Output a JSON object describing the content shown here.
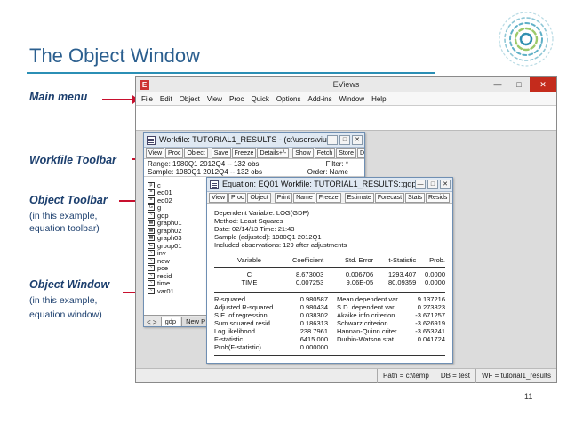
{
  "slide": {
    "title": "The Object Window",
    "page_number": "11"
  },
  "labels": {
    "main_menu": "Main menu",
    "workfile_toolbar": "Workfile Toolbar",
    "object_toolbar": "Object Toolbar",
    "object_toolbar_sub1": "(in this example,",
    "object_toolbar_sub2": "equation toolbar)",
    "object_window": "Object Window",
    "object_window_sub1": "(in this example,",
    "object_window_sub2": "equation window)"
  },
  "colors": {
    "title": "#2b5f8f",
    "label": "#1c3f6e",
    "arrow": "#c8102e",
    "close_button": "#c42b1c"
  },
  "eviews": {
    "app_title": "EViews",
    "menu": [
      "File",
      "Edit",
      "Object",
      "View",
      "Proc",
      "Quick",
      "Options",
      "Add-ins",
      "Window",
      "Help"
    ],
    "status": {
      "path": "Path = c:\\temp",
      "db": "DB = test",
      "wf": "WF = tutorial1_results"
    }
  },
  "workfile": {
    "title": "Workfile: TUTORIAL1_RESULTS - (c:\\users\\viu3...",
    "toolbar": [
      "View",
      "Proc",
      "Object",
      "Save",
      "Freeze",
      "Details+/-",
      "Show",
      "Fetch",
      "Store",
      "Delete",
      "Ge"
    ],
    "range_label": "Range:  1980Q1 2012Q4  --  132 obs",
    "sample_label": "Sample: 1980Q1 2012Q4  --  132 obs",
    "filter": "Filter: *",
    "order": "Order: Name",
    "objects": [
      {
        "glyph": "β",
        "name": "c"
      },
      {
        "glyph": "=",
        "name": "eq01"
      },
      {
        "glyph": "=",
        "name": "eq02"
      },
      {
        "glyph": "G",
        "name": "g"
      },
      {
        "glyph": "~",
        "name": "gdp"
      },
      {
        "glyph": "▦",
        "name": "graph01"
      },
      {
        "glyph": "▦",
        "name": "graph02"
      },
      {
        "glyph": "▦",
        "name": "graph03"
      },
      {
        "glyph": "G",
        "name": "group01"
      },
      {
        "glyph": "~",
        "name": "inv"
      },
      {
        "glyph": "~",
        "name": "new"
      },
      {
        "glyph": "~",
        "name": "pce"
      },
      {
        "glyph": "~",
        "name": "resid"
      },
      {
        "glyph": "~",
        "name": "time"
      },
      {
        "glyph": "~",
        "name": "var01"
      }
    ],
    "tabs": [
      "gdp",
      "New P"
    ],
    "nav_glyph": "< >"
  },
  "equation": {
    "title": "Equation: EQ01   Workfile: TUTORIAL1_RESULTS::gdp\\",
    "toolbar": [
      "View",
      "Proc",
      "Object",
      "Print",
      "Name",
      "Freeze",
      "Estimate",
      "Forecast",
      "Stats",
      "Resids"
    ],
    "header": [
      "Dependent Variable: LOG(GDP)",
      "Method: Least Squares",
      "Date: 02/14/13   Time: 21:43",
      "Sample (adjusted): 1980Q1 2012Q1",
      "Included observations: 129 after adjustments"
    ],
    "columns": [
      "Variable",
      "Coefficient",
      "Std. Error",
      "t-Statistic",
      "Prob."
    ],
    "rows": [
      [
        "C",
        "8.673003",
        "0.006706",
        "1293.407",
        "0.0000"
      ],
      [
        "TIME",
        "0.007253",
        "9.06E-05",
        "80.09359",
        "0.0000"
      ]
    ],
    "stats": [
      [
        "R-squared",
        "0.980587",
        "Mean dependent var",
        "9.137216"
      ],
      [
        "Adjusted R-squared",
        "0.980434",
        "S.D. dependent var",
        "0.273823"
      ],
      [
        "S.E. of regression",
        "0.038302",
        "Akaike info criterion",
        "-3.671257"
      ],
      [
        "Sum squared resid",
        "0.186313",
        "Schwarz criterion",
        "-3.626919"
      ],
      [
        "Log likelihood",
        "238.7961",
        "Hannan-Quinn criter.",
        "-3.653241"
      ],
      [
        "F-statistic",
        "6415.000",
        "Durbin-Watson stat",
        "0.041724"
      ],
      [
        "Prob(F-statistic)",
        "0.000000",
        "",
        ""
      ]
    ]
  }
}
